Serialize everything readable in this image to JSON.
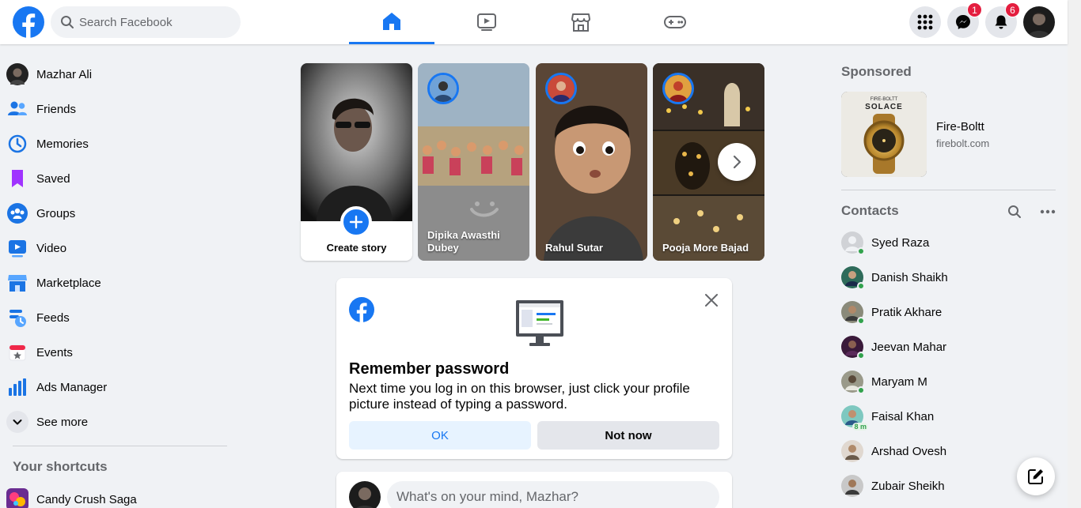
{
  "search": {
    "placeholder": "Search Facebook"
  },
  "nav": {
    "tabs": [
      "Home",
      "Video",
      "Marketplace",
      "Gaming"
    ],
    "active": "Home"
  },
  "header_actions": {
    "messenger_badge": "1",
    "notifications_badge": "6"
  },
  "user": {
    "name": "Mazhar Ali"
  },
  "sidebar": {
    "items": [
      {
        "label": "Mazhar Ali",
        "icon": "profile-avatar"
      },
      {
        "label": "Friends",
        "icon": "friends-icon"
      },
      {
        "label": "Memories",
        "icon": "memories-icon"
      },
      {
        "label": "Saved",
        "icon": "saved-icon"
      },
      {
        "label": "Groups",
        "icon": "groups-icon"
      },
      {
        "label": "Video",
        "icon": "video-icon"
      },
      {
        "label": "Marketplace",
        "icon": "marketplace-icon"
      },
      {
        "label": "Feeds",
        "icon": "feeds-icon"
      },
      {
        "label": "Events",
        "icon": "events-icon"
      },
      {
        "label": "Ads Manager",
        "icon": "ads-manager-icon"
      },
      {
        "label": "See more",
        "icon": "chevron-down-icon"
      }
    ],
    "shortcuts_heading": "Your shortcuts",
    "shortcuts": [
      {
        "label": "Candy Crush Saga"
      }
    ]
  },
  "stories": {
    "create_label": "Create story",
    "items": [
      {
        "name": "Dipika Awasthi Dubey"
      },
      {
        "name": "Rahul Sutar"
      },
      {
        "name": "Pooja More Bajad"
      }
    ]
  },
  "remember_password": {
    "title": "Remember password",
    "body": "Next time you log in on this browser, just click your profile picture instead of typing a password.",
    "ok_label": "OK",
    "not_now_label": "Not now"
  },
  "composer": {
    "placeholder": "What's on your mind, Mazhar?"
  },
  "sponsored": {
    "heading": "Sponsored",
    "ad": {
      "name": "Fire-Boltt",
      "domain": "firebolt.com",
      "brand_text": "FIRE-BOLTT",
      "product_text": "SOLACE"
    }
  },
  "contacts": {
    "heading": "Contacts",
    "items": [
      {
        "name": "Syed Raza",
        "status": "online"
      },
      {
        "name": "Danish Shaikh",
        "status": "online"
      },
      {
        "name": "Pratik Akhare",
        "status": "online"
      },
      {
        "name": "Jeevan Mahar",
        "status": "online"
      },
      {
        "name": "Maryam M",
        "status": "online"
      },
      {
        "name": "Faisal Khan",
        "status": "8 m"
      },
      {
        "name": "Arshad Ovesh",
        "status": ""
      },
      {
        "name": "Zubair Sheikh",
        "status": ""
      }
    ]
  },
  "colors": {
    "brand": "#1877f2",
    "background": "#f0f2f5",
    "badge": "#e41e3f",
    "online": "#31a24c"
  }
}
